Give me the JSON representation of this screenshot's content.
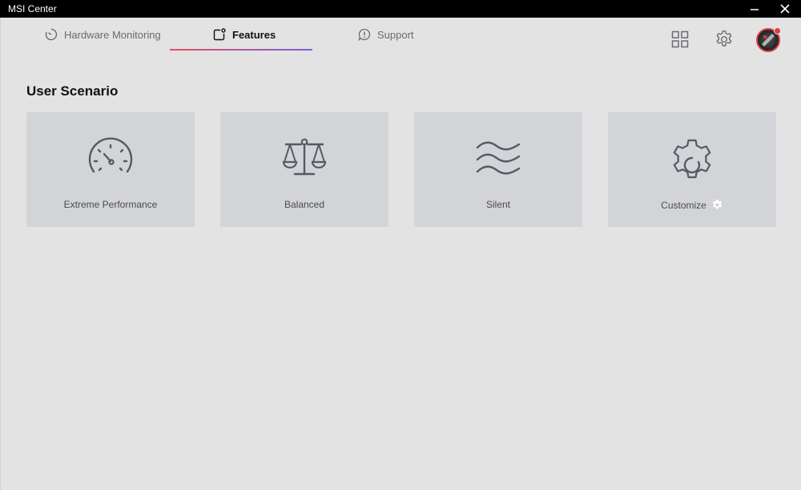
{
  "window": {
    "title": "MSI Center"
  },
  "nav": {
    "tabs": [
      {
        "label": "Hardware Monitoring",
        "icon": "gauge-icon",
        "active": false
      },
      {
        "label": "Features",
        "icon": "features-icon",
        "active": true
      },
      {
        "label": "Support",
        "icon": "support-icon",
        "active": false
      }
    ]
  },
  "header_icons": [
    "apps-grid-icon",
    "settings-gear-icon",
    "avatar"
  ],
  "main": {
    "section_title": "User Scenario",
    "scenarios": [
      {
        "label": "Extreme Performance",
        "icon": "speedometer-icon"
      },
      {
        "label": "Balanced",
        "icon": "balance-scale-icon"
      },
      {
        "label": "Silent",
        "icon": "waves-icon"
      },
      {
        "label": "Customize",
        "icon": "gear-icon"
      }
    ]
  },
  "colors": {
    "background": "#e3e3e4",
    "card": "#d3d4d8",
    "titlebar": "#000000",
    "accent_start": "#e0525f",
    "accent_end": "#7f5fd8",
    "notification": "#e23b45"
  }
}
